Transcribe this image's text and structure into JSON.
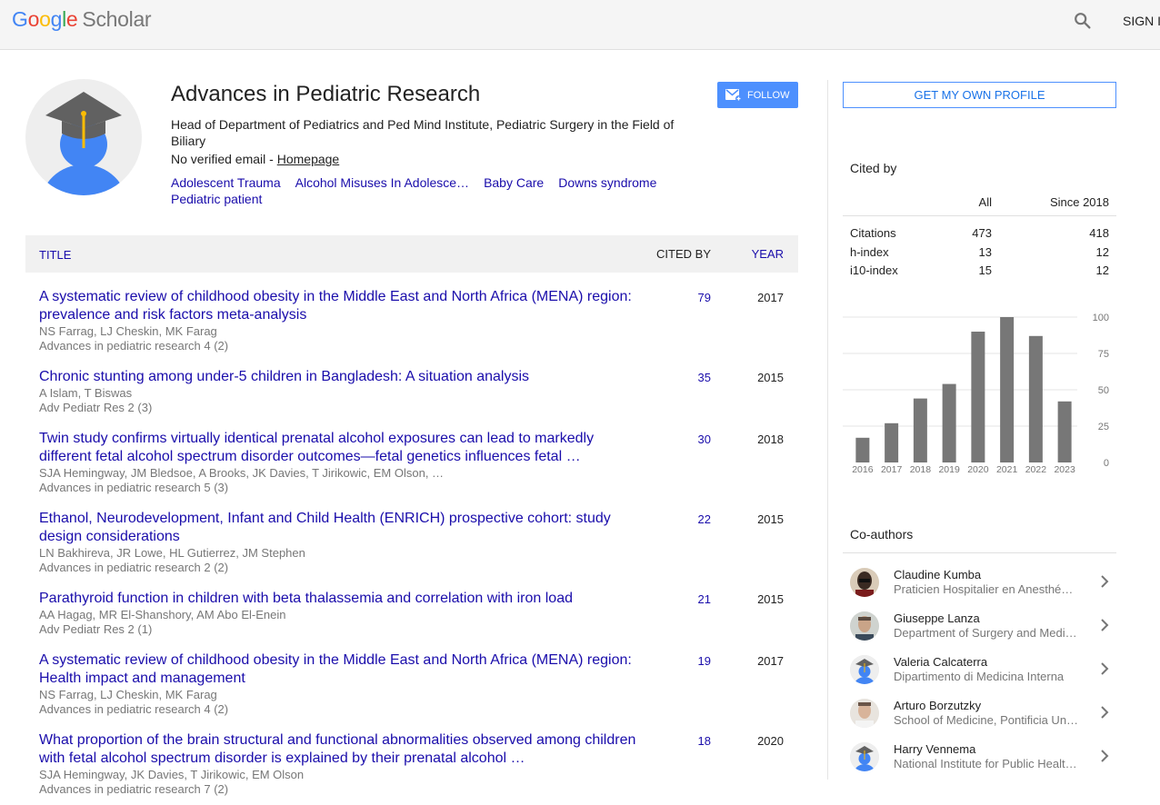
{
  "brand": {
    "google": "Google",
    "scholar": "Scholar"
  },
  "header": {
    "signin_label": "SIGN IN",
    "search_icon": "search-icon"
  },
  "profile": {
    "name": "Advances in Pediatric Research",
    "affiliation": "Head of Department of Pediatrics and Ped Mind Institute, Pediatric Surgery in the Field of Biliary",
    "email_text": "No verified email -",
    "homepage_label": "Homepage",
    "follow_label": "FOLLOW",
    "interests": [
      "Adolescent Trauma",
      "Alcohol Misuses In Adolesce…",
      "Baby Care",
      "Downs syndrome",
      "Pediatric patient"
    ]
  },
  "table_header": {
    "title": "TITLE",
    "cited_by": "CITED BY",
    "year": "YEAR"
  },
  "articles": [
    {
      "title": "A systematic review of childhood obesity in the Middle East and North Africa (MENA) region: prevalence and risk factors meta-analysis",
      "authors": "NS Farrag, LJ Cheskin, MK Farag",
      "venue": "Advances in pediatric research 4 (2)",
      "cited": "79",
      "year": "2017"
    },
    {
      "title": "Chronic stunting among under-5 children in Bangladesh: A situation analysis",
      "authors": "A Islam, T Biswas",
      "venue": "Adv Pediatr Res 2 (3)",
      "cited": "35",
      "year": "2015"
    },
    {
      "title": "Twin study confirms virtually identical prenatal alcohol exposures can lead to markedly different fetal alcohol spectrum disorder outcomes—fetal genetics influences fetal …",
      "authors": "SJA Hemingway, JM Bledsoe, A Brooks, JK Davies, T Jirikowic, EM Olson, …",
      "venue": "Advances in pediatric research 5 (3)",
      "cited": "30",
      "year": "2018"
    },
    {
      "title": "Ethanol, Neurodevelopment, Infant and Child Health (ENRICH) prospective cohort: study design considerations",
      "authors": "LN Bakhireva, JR Lowe, HL Gutierrez, JM Stephen",
      "venue": "Advances in pediatric research 2 (2)",
      "cited": "22",
      "year": "2015"
    },
    {
      "title": "Parathyroid function in children with beta thalassemia and correlation with iron load",
      "authors": "AA Hagag, MR El-Shanshory, AM Abo El-Enein",
      "venue": "Adv Pediatr Res 2 (1)",
      "cited": "21",
      "year": "2015"
    },
    {
      "title": "A systematic review of childhood obesity in the Middle East and North Africa (MENA) region: Health impact and management",
      "authors": "NS Farrag, LJ Cheskin, MK Farag",
      "venue": "Advances in pediatric research 4 (2)",
      "cited": "19",
      "year": "2017"
    },
    {
      "title": "What proportion of the brain structural and functional abnormalities observed among children with fetal alcohol spectrum disorder is explained by their prenatal alcohol …",
      "authors": "SJA Hemingway, JK Davies, T Jirikowic, EM Olson",
      "venue": "Advances in pediatric research 7 (2)",
      "cited": "18",
      "year": "2020"
    }
  ],
  "sidebar": {
    "get_profile_label": "GET MY OWN PROFILE",
    "cited_by_heading": "Cited by",
    "col_all": "All",
    "col_since": "Since 2018",
    "metrics": [
      {
        "label": "Citations",
        "all": "473",
        "since": "418"
      },
      {
        "label": "h-index",
        "all": "13",
        "since": "12"
      },
      {
        "label": "i10-index",
        "all": "15",
        "since": "12"
      }
    ],
    "coauthors_heading": "Co-authors",
    "coauthors": [
      {
        "name": "Claudine Kumba",
        "affiliation": "Praticien Hospitalier en Anesthé…"
      },
      {
        "name": "Giuseppe Lanza",
        "affiliation": "Department of Surgery and Medi…"
      },
      {
        "name": "Valeria Calcaterra",
        "affiliation": "Dipartimento di Medicina Interna"
      },
      {
        "name": "Arturo Borzutzky",
        "affiliation": "School of Medicine, Pontificia Un…"
      },
      {
        "name": "Harry Vennema",
        "affiliation": "National Institute for Public Healt…"
      }
    ]
  },
  "chart_data": {
    "type": "bar",
    "categories": [
      "2016",
      "2017",
      "2018",
      "2019",
      "2020",
      "2021",
      "2022",
      "2023"
    ],
    "values": [
      17,
      27,
      44,
      54,
      90,
      100,
      87,
      42
    ],
    "ylim": [
      0,
      100
    ],
    "yticks": [
      "0",
      "25",
      "50",
      "75",
      "100"
    ],
    "bar_color": "#777777"
  }
}
